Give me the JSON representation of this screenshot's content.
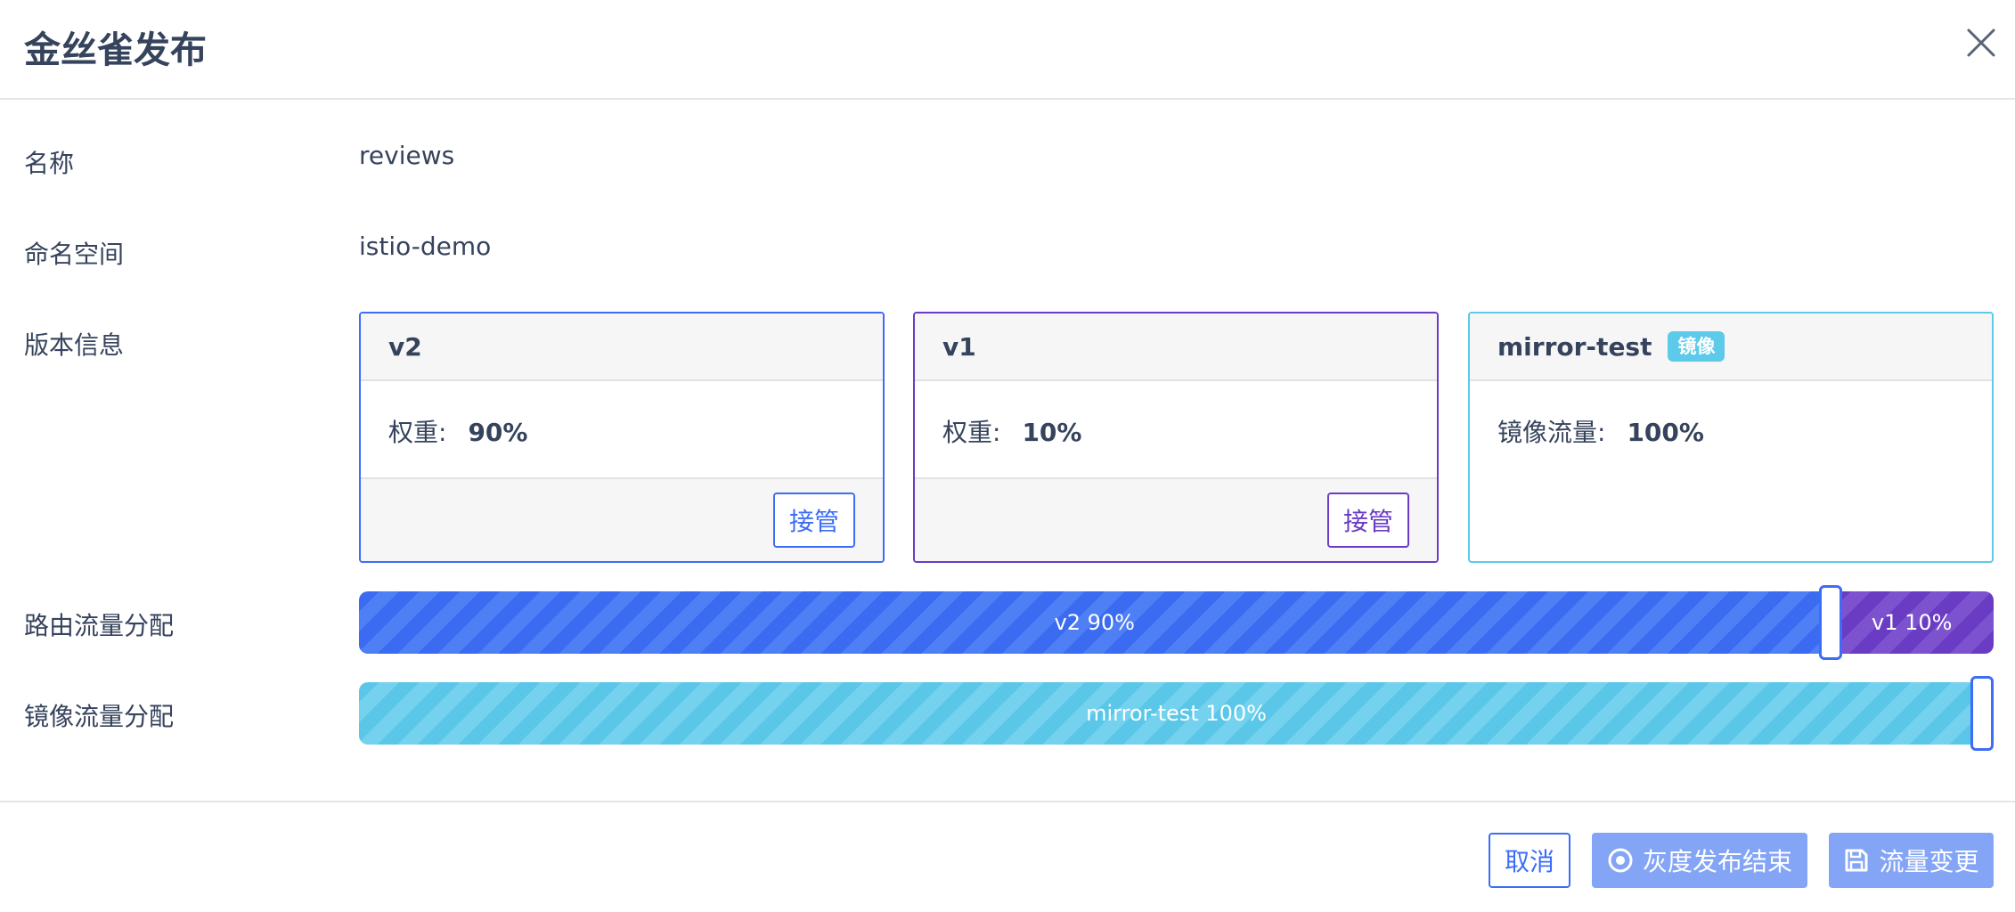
{
  "dialog": {
    "title": "金丝雀发布"
  },
  "fields": {
    "name_label": "名称",
    "name_value": "reviews",
    "namespace_label": "命名空间",
    "namespace_value": "istio-demo",
    "versions_label": "版本信息",
    "routing_label": "路由流量分配",
    "mirror_label": "镜像流量分配"
  },
  "versions": [
    {
      "name": "v2",
      "weight_label": "权重:",
      "weight": "90%",
      "action_label": "接管",
      "color": "#3d6df6"
    },
    {
      "name": "v1",
      "weight_label": "权重:",
      "weight": "10%",
      "action_label": "接管",
      "color": "#6a3cc4"
    },
    {
      "name": "mirror-test",
      "badge": "镜像",
      "weight_label": "镜像流量:",
      "weight": "100%",
      "color": "#5ccae8"
    }
  ],
  "routing": {
    "segments": [
      {
        "label": "v2 90%",
        "percent": 90,
        "color": "#3a6bf0"
      },
      {
        "label": "v1 10%",
        "percent": 10,
        "color": "#6a3cc4"
      }
    ]
  },
  "mirror": {
    "segments": [
      {
        "label": "mirror-test 100%",
        "percent": 100,
        "color": "#5bc7e8"
      }
    ]
  },
  "footer": {
    "cancel_label": "取消",
    "end_label": "灰度发布结束",
    "change_label": "流量变更"
  },
  "icons": {
    "close": "close-icon",
    "end": "stop-circle-icon",
    "change": "save-icon"
  },
  "colors": {
    "primary": "#3d6df6",
    "disabled_primary": "#84a5f6",
    "text": "#36435c"
  }
}
